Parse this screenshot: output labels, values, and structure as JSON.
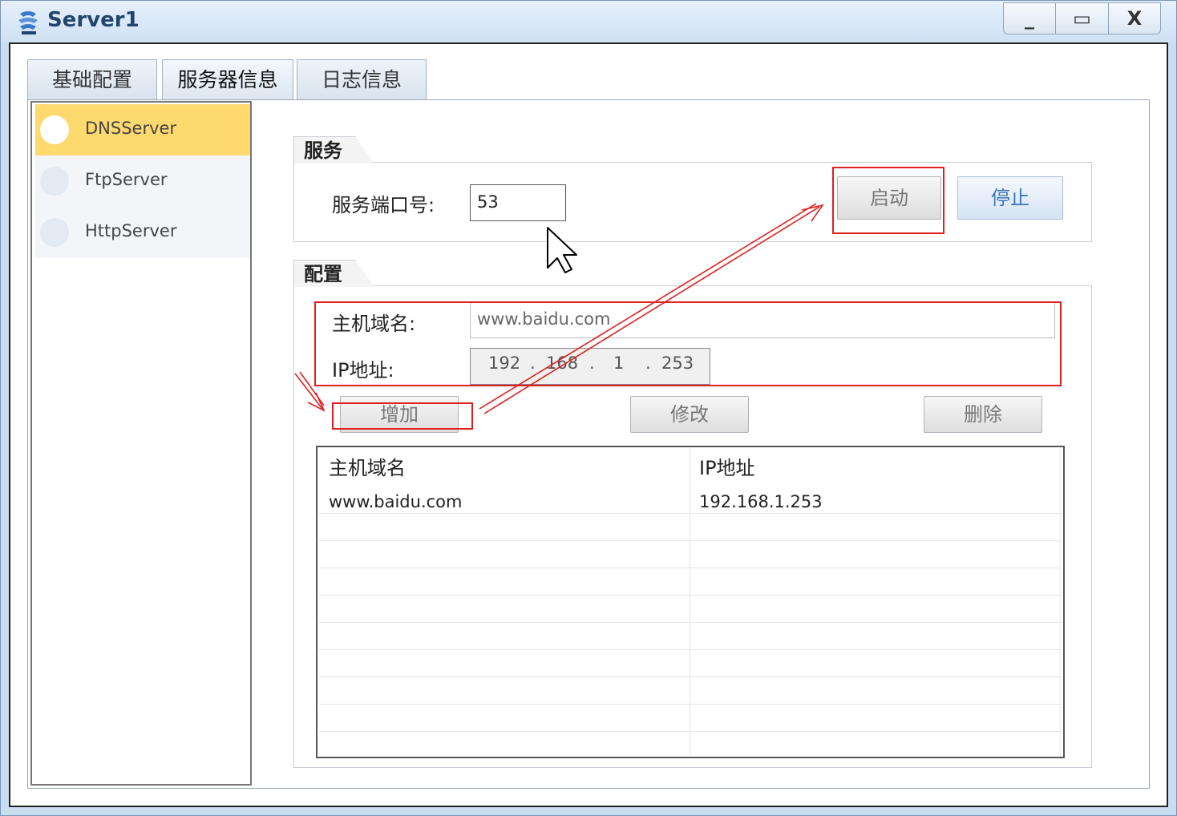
{
  "window": {
    "title": "Server1",
    "minimize_glyph": "_",
    "maximize_glyph": "▭",
    "close_glyph": "X"
  },
  "tabs": [
    {
      "label": "基础配置",
      "active": false
    },
    {
      "label": "服务器信息",
      "active": true
    },
    {
      "label": "日志信息",
      "active": false
    }
  ],
  "sidebar": {
    "items": [
      {
        "label": "DNSServer",
        "selected": true
      },
      {
        "label": "FtpServer",
        "selected": false
      },
      {
        "label": "HttpServer",
        "selected": false
      }
    ]
  },
  "service": {
    "group_title": "服务",
    "port_label": "服务端口号:",
    "port_value": "53",
    "start_label": "启动",
    "stop_label": "停止"
  },
  "config": {
    "group_title": "配置",
    "host_label": "主机域名:",
    "host_value": "www.baidu.com",
    "ip_label": "IP地址:",
    "ip_parts": [
      "192",
      "168",
      "1",
      "253"
    ],
    "add_label": "增加",
    "modify_label": "修改",
    "delete_label": "删除"
  },
  "table": {
    "headers": [
      "主机域名",
      "IP地址"
    ],
    "rows": [
      [
        "www.baidu.com",
        "192.168.1.253"
      ]
    ]
  },
  "colors": {
    "selected_item": "#fdd96e",
    "annotation_red": "#e02020",
    "stop_text": "#3c74b8"
  }
}
